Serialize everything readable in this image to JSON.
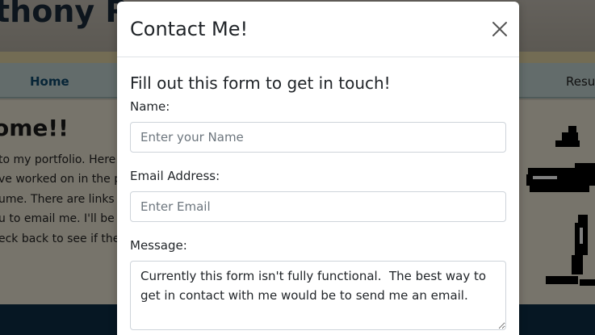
{
  "background": {
    "site_title": "thony Ra",
    "nav": {
      "home": "Home",
      "resume": "Resu"
    },
    "welcome": "ome!!",
    "paragraph_lines": [
      "to my portfolio. Here",
      "ve worked on in the p",
      "ume. There are links",
      "u to email me. I'll be",
      "eck back to see if the"
    ]
  },
  "modal": {
    "title": "Contact Me!",
    "close_icon": "close-icon",
    "form": {
      "heading": "Fill out this form to get in touch!",
      "name_label": "Name:",
      "name_placeholder": "Enter your Name",
      "email_label": "Email Address:",
      "email_placeholder": "Enter Email",
      "message_label": "Message:",
      "message_value": "Currently this form isn't fully functional.  The best way to get in contact with me would be to send me an email."
    }
  },
  "colors": {
    "backdrop": "#000000",
    "footer": "#0d2f47",
    "nav_link": "#0e4a6e"
  }
}
